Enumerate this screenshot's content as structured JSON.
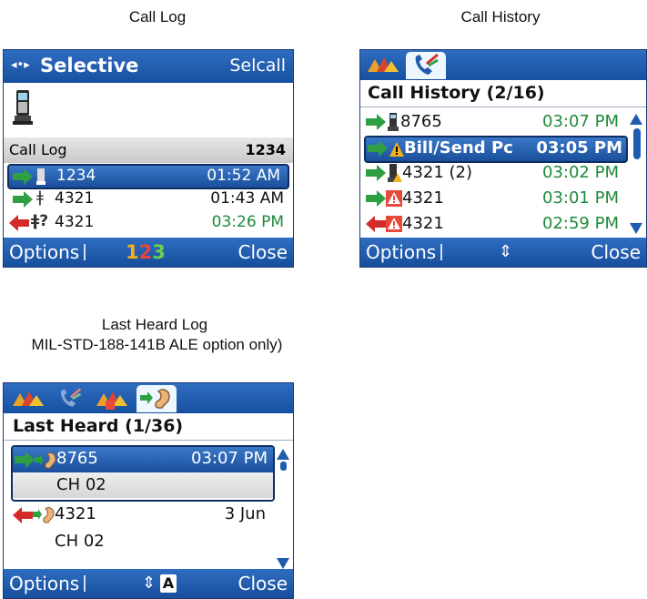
{
  "captions": {
    "call_log": "Call Log",
    "call_history": "Call History",
    "last_heard_line1": "Last Heard Log",
    "last_heard_line2": "MIL-STD-188-141B ALE option only)"
  },
  "call_log_screen": {
    "mode": "Selective",
    "mode_right": "Selcall",
    "section_title": "Call Log",
    "section_value": "1234",
    "rows": [
      {
        "number": "1234",
        "time": "01:52 AM",
        "direction": "outgoing",
        "selected": true
      },
      {
        "number": "4321",
        "time": "01:43 AM",
        "direction": "outgoing",
        "selected": false
      },
      {
        "number": "4321",
        "time": "03:26 PM",
        "direction": "incoming",
        "selected": false
      }
    ],
    "softkeys": {
      "left": "Options",
      "center": "123",
      "right": "Close"
    }
  },
  "call_history_screen": {
    "title": "Call History (2/16)",
    "rows": [
      {
        "number": "8765",
        "time": "03:07 PM",
        "selected": false
      },
      {
        "number": "Bill/Send Pc",
        "time": "03:05 PM",
        "selected": true
      },
      {
        "number": "4321 (2)",
        "time": "03:02 PM",
        "selected": false
      },
      {
        "number": "4321",
        "time": "03:01 PM",
        "selected": false
      },
      {
        "number": "4321",
        "time": "02:59 PM",
        "selected": false
      }
    ],
    "softkeys": {
      "left": "Options",
      "right": "Close"
    }
  },
  "last_heard_screen": {
    "title": "Last Heard (1/36)",
    "entries": [
      {
        "number": "8765",
        "time": "03:07 PM",
        "channel": "CH 02",
        "selected": true
      },
      {
        "number": "4321",
        "time": "3 Jun",
        "channel": "CH 02",
        "selected": false
      }
    ],
    "softkeys": {
      "left": "Options",
      "center": "A",
      "right": "Close"
    }
  },
  "colors": {
    "bar_blue": "#1f5cb0",
    "green_time": "#1f8a3a",
    "green_arrow": "#2ea043",
    "red_arrow": "#d42a2a"
  }
}
